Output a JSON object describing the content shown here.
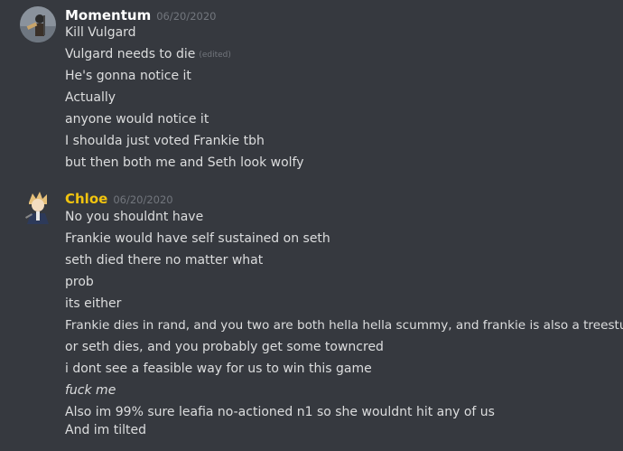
{
  "colors": {
    "background": "#36393f",
    "message_text": "#dcddde",
    "timestamp": "#72767d",
    "momentum_name": "#ffffff",
    "chloe_name": "#f1c40f"
  },
  "messages": [
    {
      "author": "Momentum",
      "timestamp": "06/20/2020",
      "avatar_icon": "user-avatar-icon",
      "lines": [
        "Kill Vulgard",
        "Vulgard needs to die",
        "He's gonna notice it",
        "Actually",
        "anyone would notice it",
        "I shoulda just voted Frankie tbh",
        "but then both me and Seth look wolfy"
      ],
      "edited_label": "(edited)"
    },
    {
      "author": "Chloe",
      "timestamp": "06/20/2020",
      "avatar_icon": "user-avatar-icon",
      "lines": [
        "No you shouldnt have",
        "Frankie would have self sustained on seth",
        "seth died there no matter what",
        "prob",
        "its either",
        "Frankie dies in rand, and you two are both hella hella scummy, and frankie is also a treestump",
        "or seth dies, and you probably get some towncred",
        "i dont see a feasible way for us to win this game",
        "fuck me",
        "Also im 99% sure leafia no-actioned n1 so she wouldnt hit any of us",
        "And im tilted"
      ]
    }
  ]
}
